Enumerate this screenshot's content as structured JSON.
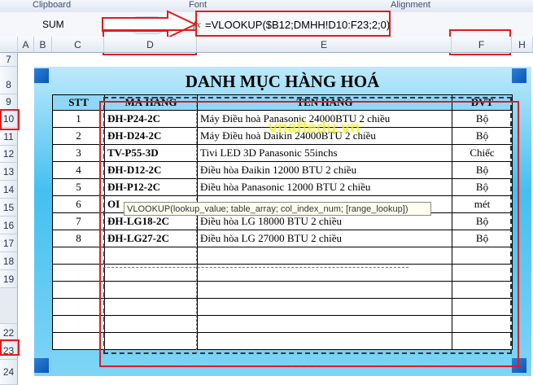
{
  "ribbon": {
    "clipboard": "Clipboard",
    "font": "Font",
    "alignment": "Alignment"
  },
  "name_box": "SUM",
  "formula_buttons": {
    "cancel": "✕",
    "enter": "✓",
    "fx": "fx"
  },
  "formula": "=VLOOKUP($B12;DMHH!D10:F23;2;0)",
  "columns": [
    "A",
    "B",
    "C",
    "D",
    "E",
    "F",
    "H"
  ],
  "rows": [
    "7",
    "8",
    "9",
    "10",
    "11",
    "12",
    "13",
    "14",
    "15",
    "16",
    "17",
    "18",
    "19",
    "22",
    "23",
    "24"
  ],
  "sheet": {
    "title": "DANH MỤC HÀNG HOÁ",
    "headers": [
      "STT",
      "MÃ HÀNG",
      "TÊN HÀNG",
      "ĐVT"
    ],
    "items": [
      {
        "stt": "1",
        "code": "ĐH-P24-2C",
        "name": "Máy Điều hoà Panasonic 24000BTU 2 chiều",
        "unit": "Bộ"
      },
      {
        "stt": "2",
        "code": "ĐH-D24-2C",
        "name": "Máy Điều hoà Daikin 24000BTU 2 chiều",
        "unit": "Bộ"
      },
      {
        "stt": "3",
        "code": "TV-P55-3D",
        "name": "Tivi LED 3D Panasonic 55inchs",
        "unit": "Chiếc"
      },
      {
        "stt": "4",
        "code": "ĐH-D12-2C",
        "name": "Điều hòa Đaikin 12000 BTU 2 chiều",
        "unit": "Bộ"
      },
      {
        "stt": "5",
        "code": "ĐH-P12-2C",
        "name": "Điều hòa Panasonic 12000 BTU 2 chiều",
        "unit": "Bộ"
      },
      {
        "stt": "6",
        "code": "OI",
        "name": "",
        "unit": "mét"
      },
      {
        "stt": "7",
        "code": "ĐH-LG18-2C",
        "name": "Điều hòa LG 18000 BTU 2 chiều",
        "unit": "Bộ"
      },
      {
        "stt": "8",
        "code": "ĐH-LG27-2C",
        "name": "Điều hòa LG 27000 BTU 2 chiều",
        "unit": "Bộ"
      }
    ]
  },
  "tooltip": "VLOOKUP(lookup_value; table_array; col_index_num; [range_lookup])",
  "watermark": "vnaftedu.vn",
  "colors": {
    "annotation": "#e31b1b",
    "frame": "#44c0ef",
    "header_fill": "#8fd7f7"
  }
}
